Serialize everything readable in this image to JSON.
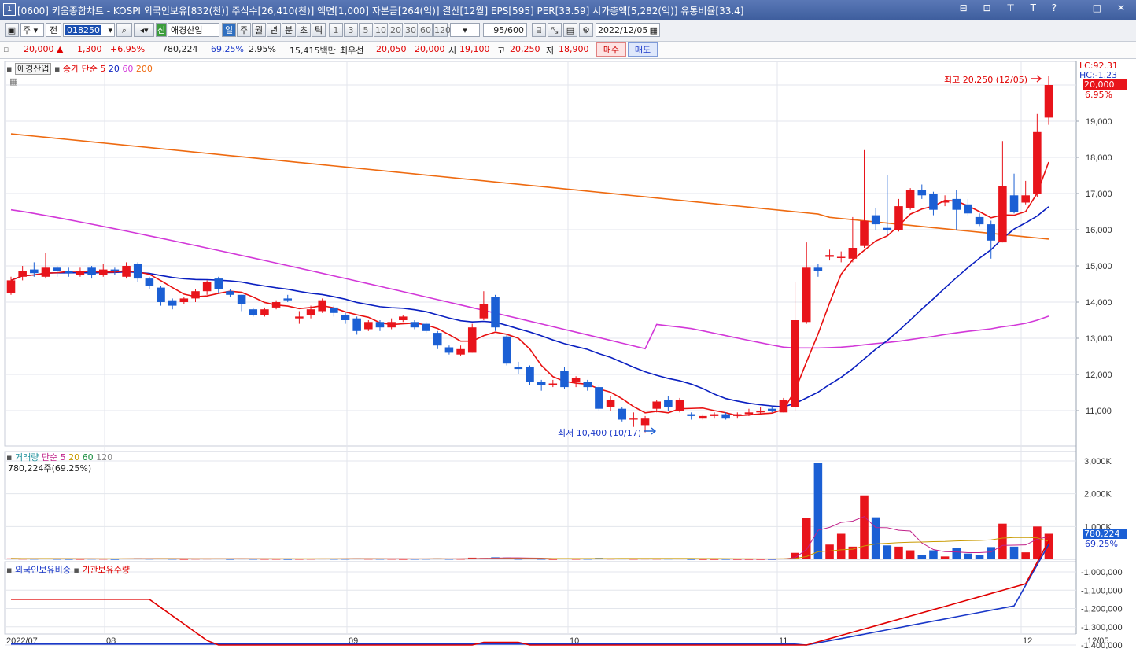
{
  "window": {
    "number": "1",
    "title": "[0600] 키움종합차트 - KOSPI 외국인보유[832(천)] 주식수[26,410(천)] 액면[1,000] 자본금[264(억)] 결산[12월] EPS[595] PER[33.59] 시가총액[5,282(억)] 유통비율[33.4]",
    "controls": "⊟ ⊡ ⊤ T ? _ □ ✕"
  },
  "toolbar": {
    "period_select": "주",
    "market_select": "전",
    "stock_code": "018250",
    "sin_label": "신",
    "stock_name": "애경산업",
    "tabs": [
      "일",
      "주",
      "월",
      "년",
      "분",
      "초",
      "틱"
    ],
    "selected_tab": "일",
    "intervals": [
      "1",
      "3",
      "5",
      "10",
      "20",
      "30",
      "60",
      "120"
    ],
    "count": "95/600",
    "date": "2022/12/05"
  },
  "quote": {
    "price": "20,000",
    "up_arrow": "▲",
    "change": "1,300",
    "change_pct": "+6.95%",
    "volume": "780,224",
    "volume_ratio": "69.25%",
    "turnover": "2.95%",
    "amount": "15,415백만",
    "best_ask_label": "최우선",
    "best_ask": "20,050",
    "best_bid": "20,000",
    "open_label": "시",
    "open": "19,100",
    "high_label": "고",
    "high": "20,250",
    "low_label": "저",
    "low": "18,900",
    "buy": "매수",
    "sell": "매도"
  },
  "price_panel": {
    "stock_tag": "애경산업",
    "ma_title": "종가 단순",
    "ma_periods": [
      "5",
      "20",
      "60",
      "200"
    ],
    "lc": "LC:92.31",
    "hc": "HC:-1.23",
    "current": "20,000",
    "current_pct": "6.95%",
    "high_annot": "최고 20,250 (12/05)",
    "low_annot": "최저 10,400 (10/17)",
    "y_ticks": [
      "19,000",
      "18,000",
      "17,000",
      "16,000",
      "15,000",
      "14,000",
      "13,000",
      "12,000",
      "11,000"
    ]
  },
  "volume_panel": {
    "title": "거래량",
    "ma_title": "단순",
    "ma_periods": [
      "5",
      "20",
      "60",
      "120"
    ],
    "info": "780,224주(69.25%)",
    "current": "780,224",
    "current_pct": "69.25%",
    "y_ticks": [
      "3,000K",
      "2,000K",
      "1,000K"
    ]
  },
  "foreign_panel": {
    "title1": "외국인보유비중",
    "title2": "기관보유수량",
    "y_ticks": [
      "-1,000,000",
      "-1,100,000",
      "-1,200,000",
      "-1,300,000",
      "-1,400,000"
    ]
  },
  "x_labels": [
    "2022/07",
    "08",
    "09",
    "10",
    "11",
    "12",
    "12/05"
  ],
  "colors": {
    "up": "#e8141b",
    "down": "#1b5fd4",
    "ma5": "#e81010",
    "ma20": "#0a1fc0",
    "ma60": "#d238d8",
    "ma200": "#ee6a10"
  },
  "chart_data": {
    "type": "candlestick",
    "x": [
      "2022/07",
      "08",
      "09",
      "10",
      "11",
      "12"
    ],
    "ylim": [
      10400,
      20250
    ],
    "candles": [
      {
        "o": 14250,
        "c": 14600,
        "h": 14700,
        "l": 14200
      },
      {
        "o": 14700,
        "c": 14850,
        "h": 15000,
        "l": 14600
      },
      {
        "o": 14900,
        "c": 14800,
        "h": 15100,
        "l": 14700
      },
      {
        "o": 14700,
        "c": 14950,
        "h": 15350,
        "l": 14650
      },
      {
        "o": 14950,
        "c": 14850,
        "h": 15000,
        "l": 14700
      },
      {
        "o": 14850,
        "c": 14800,
        "h": 14950,
        "l": 14700
      },
      {
        "o": 14750,
        "c": 14850,
        "h": 14950,
        "l": 14700
      },
      {
        "o": 14950,
        "c": 14750,
        "h": 15000,
        "l": 14650
      },
      {
        "o": 14750,
        "c": 14900,
        "h": 15050,
        "l": 14700
      },
      {
        "o": 14900,
        "c": 14850,
        "h": 14950,
        "l": 14750
      },
      {
        "o": 14700,
        "c": 15000,
        "h": 15100,
        "l": 14650
      },
      {
        "o": 15050,
        "c": 14650,
        "h": 15100,
        "l": 14550
      },
      {
        "o": 14650,
        "c": 14450,
        "h": 14700,
        "l": 14350
      },
      {
        "o": 14400,
        "c": 14000,
        "h": 14450,
        "l": 13900
      },
      {
        "o": 14050,
        "c": 13900,
        "h": 14100,
        "l": 13800
      },
      {
        "o": 14000,
        "c": 14100,
        "h": 14150,
        "l": 13950
      },
      {
        "o": 14100,
        "c": 14300,
        "h": 14350,
        "l": 14000
      },
      {
        "o": 14300,
        "c": 14550,
        "h": 14600,
        "l": 14200
      },
      {
        "o": 14650,
        "c": 14350,
        "h": 14700,
        "l": 14250
      },
      {
        "o": 14300,
        "c": 14200,
        "h": 14350,
        "l": 14150
      },
      {
        "o": 14200,
        "c": 13950,
        "h": 14200,
        "l": 13750
      },
      {
        "o": 13800,
        "c": 13650,
        "h": 13850,
        "l": 13600
      },
      {
        "o": 13650,
        "c": 13800,
        "h": 13850,
        "l": 13600
      },
      {
        "o": 13850,
        "c": 14000,
        "h": 14050,
        "l": 13800
      },
      {
        "o": 14100,
        "c": 14050,
        "h": 14200,
        "l": 14000
      },
      {
        "o": 13550,
        "c": 13600,
        "h": 13750,
        "l": 13400
      },
      {
        "o": 13650,
        "c": 13800,
        "h": 13900,
        "l": 13550
      },
      {
        "o": 13750,
        "c": 14050,
        "h": 14100,
        "l": 13700
      },
      {
        "o": 13850,
        "c": 13700,
        "h": 13900,
        "l": 13600
      },
      {
        "o": 13650,
        "c": 13500,
        "h": 13700,
        "l": 13400
      },
      {
        "o": 13550,
        "c": 13200,
        "h": 13600,
        "l": 13100
      },
      {
        "o": 13250,
        "c": 13450,
        "h": 13500,
        "l": 13200
      },
      {
        "o": 13450,
        "c": 13300,
        "h": 13500,
        "l": 13200
      },
      {
        "o": 13300,
        "c": 13450,
        "h": 13550,
        "l": 13250
      },
      {
        "o": 13500,
        "c": 13600,
        "h": 13650,
        "l": 13450
      },
      {
        "o": 13450,
        "c": 13300,
        "h": 13500,
        "l": 13250
      },
      {
        "o": 13400,
        "c": 13200,
        "h": 13450,
        "l": 13150
      },
      {
        "o": 13150,
        "c": 12800,
        "h": 13200,
        "l": 12700
      },
      {
        "o": 12750,
        "c": 12600,
        "h": 12800,
        "l": 12550
      },
      {
        "o": 12550,
        "c": 12700,
        "h": 12800,
        "l": 12500
      },
      {
        "o": 12600,
        "c": 13300,
        "h": 13400,
        "l": 12600
      },
      {
        "o": 13550,
        "c": 13950,
        "h": 14300,
        "l": 13500
      },
      {
        "o": 14150,
        "c": 13300,
        "h": 14200,
        "l": 13200
      },
      {
        "o": 13050,
        "c": 12300,
        "h": 13100,
        "l": 12250
      },
      {
        "o": 12200,
        "c": 12150,
        "h": 12350,
        "l": 12000
      },
      {
        "o": 12200,
        "c": 11800,
        "h": 12250,
        "l": 11700
      },
      {
        "o": 11800,
        "c": 11700,
        "h": 11850,
        "l": 11550
      },
      {
        "o": 11700,
        "c": 11750,
        "h": 11850,
        "l": 11650
      },
      {
        "o": 12100,
        "c": 11650,
        "h": 12200,
        "l": 11600
      },
      {
        "o": 11800,
        "c": 11900,
        "h": 11950,
        "l": 11650
      },
      {
        "o": 11800,
        "c": 11650,
        "h": 11850,
        "l": 11550
      },
      {
        "o": 11650,
        "c": 11050,
        "h": 11700,
        "l": 11000
      },
      {
        "o": 11100,
        "c": 11300,
        "h": 11400,
        "l": 11000
      },
      {
        "o": 11050,
        "c": 10750,
        "h": 11100,
        "l": 10700
      },
      {
        "o": 10750,
        "c": 10800,
        "h": 10950,
        "l": 10550
      },
      {
        "o": 10600,
        "c": 10800,
        "h": 10850,
        "l": 10400
      },
      {
        "o": 11050,
        "c": 11250,
        "h": 11300,
        "l": 10950
      },
      {
        "o": 11300,
        "c": 11100,
        "h": 11400,
        "l": 11000
      },
      {
        "o": 11000,
        "c": 11300,
        "h": 11350,
        "l": 10950
      },
      {
        "o": 10900,
        "c": 10850,
        "h": 10950,
        "l": 10750
      },
      {
        "o": 10800,
        "c": 10850,
        "h": 10900,
        "l": 10750
      },
      {
        "o": 10850,
        "c": 10900,
        "h": 10950,
        "l": 10800
      },
      {
        "o": 10900,
        "c": 10800,
        "h": 10950,
        "l": 10750
      },
      {
        "o": 10850,
        "c": 10900,
        "h": 10950,
        "l": 10800
      },
      {
        "o": 10900,
        "c": 10950,
        "h": 11050,
        "l": 10850
      },
      {
        "o": 10950,
        "c": 11000,
        "h": 11100,
        "l": 10900
      },
      {
        "o": 11050,
        "c": 11000,
        "h": 11100,
        "l": 10950
      },
      {
        "o": 10950,
        "c": 11300,
        "h": 11350,
        "l": 10950
      },
      {
        "o": 11100,
        "c": 13500,
        "h": 14550,
        "l": 11000
      },
      {
        "o": 13450,
        "c": 14950,
        "h": 15650,
        "l": 13400
      },
      {
        "o": 14950,
        "c": 14850,
        "h": 15050,
        "l": 14700
      },
      {
        "o": 15250,
        "c": 15300,
        "h": 15450,
        "l": 15150
      },
      {
        "o": 15250,
        "c": 15250,
        "h": 15400,
        "l": 15100
      },
      {
        "o": 15200,
        "c": 15500,
        "h": 16350,
        "l": 15100
      },
      {
        "o": 15550,
        "c": 16250,
        "h": 18200,
        "l": 15500
      },
      {
        "o": 16400,
        "c": 16150,
        "h": 16600,
        "l": 16000
      },
      {
        "o": 16050,
        "c": 16000,
        "h": 17500,
        "l": 15850
      },
      {
        "o": 16000,
        "c": 16650,
        "h": 16850,
        "l": 15950
      },
      {
        "o": 16600,
        "c": 17100,
        "h": 17150,
        "l": 16550
      },
      {
        "o": 17100,
        "c": 16950,
        "h": 17250,
        "l": 16850
      },
      {
        "o": 17000,
        "c": 16550,
        "h": 17050,
        "l": 16400
      },
      {
        "o": 16750,
        "c": 16800,
        "h": 16950,
        "l": 16650
      },
      {
        "o": 16850,
        "c": 16550,
        "h": 17100,
        "l": 16000
      },
      {
        "o": 16700,
        "c": 16450,
        "h": 16850,
        "l": 16400
      },
      {
        "o": 16350,
        "c": 16150,
        "h": 16450,
        "l": 16100
      },
      {
        "o": 16150,
        "c": 15700,
        "h": 16250,
        "l": 15200
      },
      {
        "o": 15650,
        "c": 17200,
        "h": 18450,
        "l": 15650
      },
      {
        "o": 16950,
        "c": 16500,
        "h": 17550,
        "l": 16450
      },
      {
        "o": 16750,
        "c": 16950,
        "h": 17350,
        "l": 16700
      },
      {
        "o": 17000,
        "c": 18700,
        "h": 19200,
        "l": 16900
      },
      {
        "o": 19100,
        "c": 20000,
        "h": 20250,
        "l": 18900
      }
    ]
  }
}
